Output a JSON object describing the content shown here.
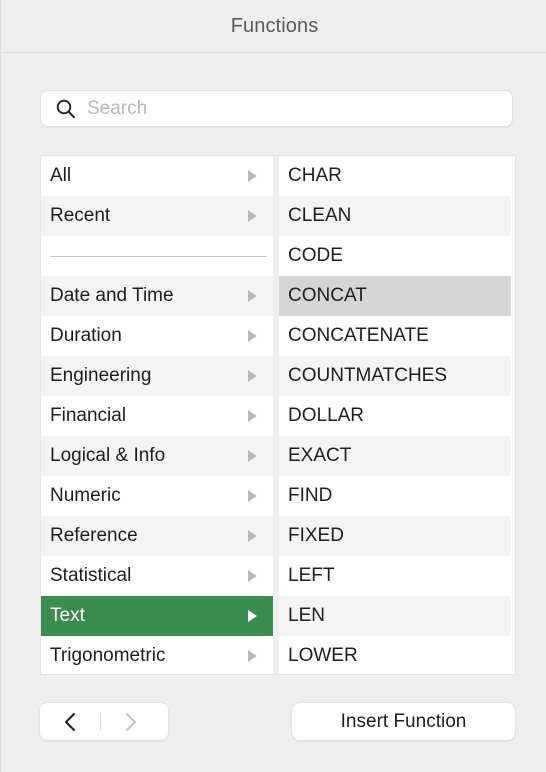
{
  "header": {
    "title": "Functions"
  },
  "search": {
    "placeholder": "Search",
    "value": "",
    "icon": "search-icon"
  },
  "categories": {
    "items": [
      {
        "label": "All",
        "type": "item",
        "selected": false,
        "disclosure": "triangle-right-icon"
      },
      {
        "label": "Recent",
        "type": "item",
        "selected": false,
        "disclosure": "triangle-right-icon"
      },
      {
        "label": "",
        "type": "separator",
        "selected": false,
        "disclosure": ""
      },
      {
        "label": "Date and Time",
        "type": "item",
        "selected": false,
        "disclosure": "triangle-right-icon"
      },
      {
        "label": "Duration",
        "type": "item",
        "selected": false,
        "disclosure": "triangle-right-icon"
      },
      {
        "label": "Engineering",
        "type": "item",
        "selected": false,
        "disclosure": "triangle-right-icon"
      },
      {
        "label": "Financial",
        "type": "item",
        "selected": false,
        "disclosure": "triangle-right-icon"
      },
      {
        "label": "Logical & Info",
        "type": "item",
        "selected": false,
        "disclosure": "triangle-right-icon"
      },
      {
        "label": "Numeric",
        "type": "item",
        "selected": false,
        "disclosure": "triangle-right-icon"
      },
      {
        "label": "Reference",
        "type": "item",
        "selected": false,
        "disclosure": "triangle-right-icon"
      },
      {
        "label": "Statistical",
        "type": "item",
        "selected": false,
        "disclosure": "triangle-right-icon"
      },
      {
        "label": "Text",
        "type": "item",
        "selected": true,
        "disclosure": "triangle-right-icon"
      },
      {
        "label": "Trigonometric",
        "type": "item",
        "selected": false,
        "disclosure": "triangle-right-icon"
      }
    ],
    "selected_label": "Text",
    "selection_color": "#3b8b4e"
  },
  "functions": {
    "items": [
      {
        "label": "CHAR",
        "active": false
      },
      {
        "label": "CLEAN",
        "active": false
      },
      {
        "label": "CODE",
        "active": false
      },
      {
        "label": "CONCAT",
        "active": true
      },
      {
        "label": "CONCATENATE",
        "active": false
      },
      {
        "label": "COUNTMATCHES",
        "active": false
      },
      {
        "label": "DOLLAR",
        "active": false
      },
      {
        "label": "EXACT",
        "active": false
      },
      {
        "label": "FIND",
        "active": false
      },
      {
        "label": "FIXED",
        "active": false
      },
      {
        "label": "LEFT",
        "active": false
      },
      {
        "label": "LEN",
        "active": false
      },
      {
        "label": "LOWER",
        "active": false
      }
    ],
    "active_label": "CONCAT",
    "active_color": "#d6d6d7"
  },
  "footer": {
    "back_icon": "chevron-left-icon",
    "forward_icon": "chevron-right-icon",
    "back_enabled": true,
    "forward_enabled": false,
    "insert_label": "Insert Function"
  }
}
